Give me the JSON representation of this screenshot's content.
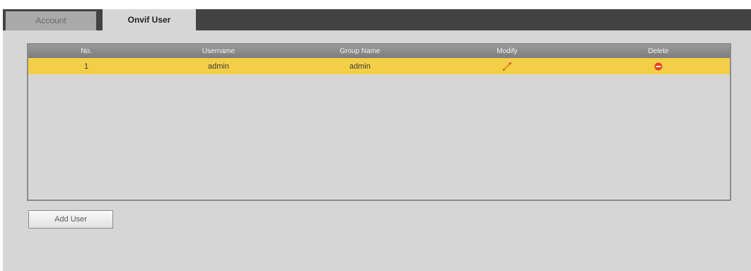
{
  "tabs": [
    {
      "label": "Account",
      "active": false
    },
    {
      "label": "Onvif User",
      "active": true
    }
  ],
  "table": {
    "columns": [
      "No.",
      "Username",
      "Group Name",
      "Modify",
      "Delete"
    ],
    "rows": [
      {
        "no": "1",
        "username": "admin",
        "group": "admin",
        "selected": true
      }
    ]
  },
  "actions": {
    "add_user": "Add User"
  },
  "colors": {
    "tab_bar": "#434343",
    "panel_background": "#d6d6d6",
    "selected_row": "#f3cf47",
    "header": "#8a8a8a",
    "delete_icon": "#e8421e",
    "modify_icon": "#e88a1e"
  },
  "icons": {
    "modify": "pencil-icon",
    "delete": "delete-icon"
  }
}
